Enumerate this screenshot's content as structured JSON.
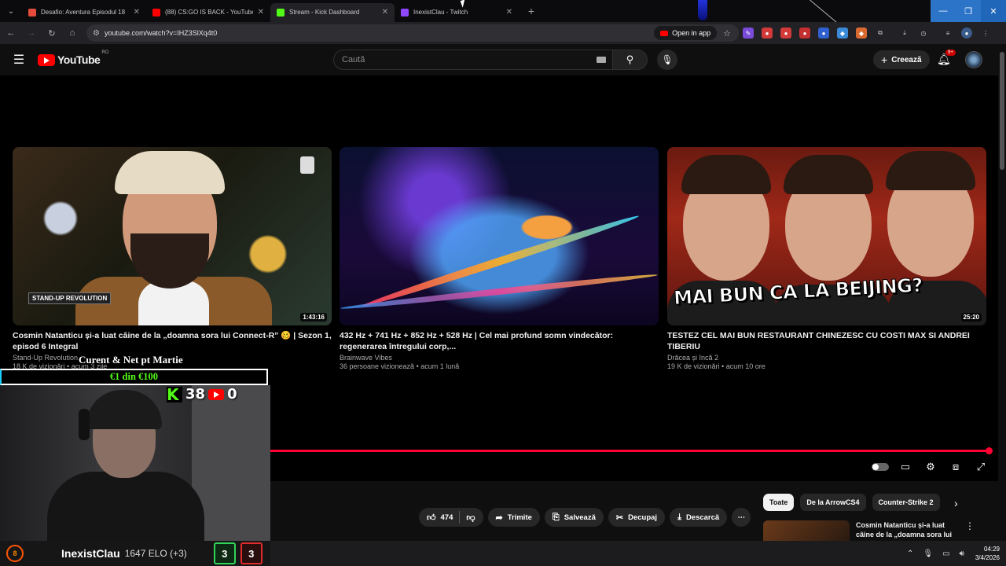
{
  "browser": {
    "tabs": [
      {
        "title": "Desafio: Aventura Episodul 18",
        "favicon_color": "#e34b3a",
        "active": false
      },
      {
        "title": "(88) CS:GO IS BACK - YouTube",
        "favicon_color": "#ff0000",
        "active": false
      },
      {
        "title": "Stream - Kick Dashboard",
        "favicon_color": "#53fc18",
        "active": true
      },
      {
        "title": "InexistClau - Twitch",
        "favicon_color": "#9146ff",
        "active": false
      }
    ],
    "url": "youtube.com/watch?v=IHZ3SlXq4t0",
    "open_in_app": "Open in app"
  },
  "youtube": {
    "logo_text": "YouTube",
    "region": "RO",
    "search_placeholder": "Caută",
    "create_label": "Creează",
    "notifications_badge": "9+"
  },
  "videos": [
    {
      "title": "Cosmin Natanticu și-a luat câine de la „doamna sora lui Connect-R” 🥴 | Sezon 1, episod 6 Integral",
      "channel": "Stand-Up Revolution",
      "meta": "18 K de vizionări • acum 3 zile",
      "duration": "1:43:16",
      "badge": "STAND-UP REVOLUTION"
    },
    {
      "title": "432 Hz + 741 Hz + 852 Hz + 528 Hz | Cel mai profund somn vindecător: regenerarea întregului corp,...",
      "channel": "Brainwave Vibes",
      "meta": "36 persoane vizionează • acum 1 lună",
      "duration": ""
    },
    {
      "title": "TESTEZ CEL MAI BUN RESTAURANT CHINEZESC CU COSTI MAX SI ANDREI TIBERIU",
      "channel": "Drăcea și încă 2",
      "meta": "19 K de vizionări • acum 10 ore",
      "duration": "25:20",
      "thumb_caption": "MAI BUN CA LA BEIJING?"
    }
  ],
  "player": {
    "progress": 1.0,
    "like_count": "474",
    "share": "Trimite",
    "save": "Salvează",
    "clip": "Decupaj",
    "download": "Descarcă"
  },
  "chips": [
    "Toate",
    "De la ArrowCS4",
    "Counter-Strike 2"
  ],
  "recommendation": {
    "title": "Cosmin Natanticu și-a luat câine de la „doamna sora lui ..."
  },
  "overlay": {
    "goal_label": "Curent & Net pt Martie",
    "goal_progress": "€1 din €100",
    "kick_count": "38",
    "youtube_count": "0"
  },
  "faceit": {
    "level": "8",
    "name": "InexistClau",
    "elo": "1647 ELO (+3)",
    "wins": "3",
    "losses": "3"
  },
  "taskbar": {
    "time": "04:29",
    "date": "3/4/2026"
  }
}
